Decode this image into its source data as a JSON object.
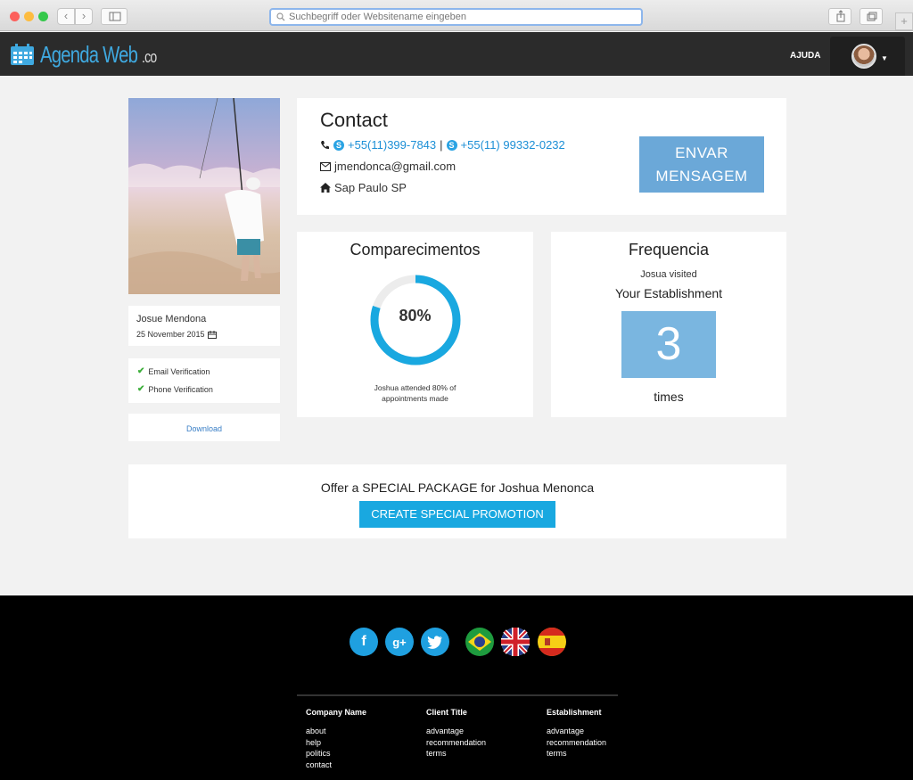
{
  "browser": {
    "url_placeholder": "Suchbegriff oder Websitename eingeben",
    "new_tab_label": "+"
  },
  "header": {
    "logo_main": "Agenda Web",
    "logo_sub": ".co",
    "help_label": "AJUDA"
  },
  "profile": {
    "name": "Josue Mendona",
    "date": "25 November 2015",
    "verifications": [
      "Email Verification",
      "Phone Verification"
    ],
    "download_label": "Download"
  },
  "contact": {
    "title": "Contact",
    "phone1": "+55(11)399-7843",
    "separator": "|",
    "phone2": "+55(11) 99332-0232",
    "email": "jmendonca@gmail.com",
    "address": "Sap Paulo SP",
    "send_label_1": "ENVAR",
    "send_label_2": "MENSAGEM"
  },
  "attendance": {
    "title": "Comparecimentos",
    "percent": 80,
    "percent_label": "80%",
    "caption_1": "Joshua attended 80% of",
    "caption_2": "appointments made"
  },
  "frequency": {
    "title": "Frequencia",
    "line1": "Josua visited",
    "line2": "Your Establishment",
    "count": "3",
    "unit": "times"
  },
  "promo": {
    "headline": "Offer a SPECIAL PACKAGE for Joshua Menonca",
    "button_label": "CREATE SPECIAL PROMOTION"
  },
  "footer": {
    "columns": [
      {
        "heading": "Company Name",
        "items": [
          "about",
          "help",
          "politics",
          "contact"
        ]
      },
      {
        "heading": "Client Title",
        "items": [
          "advantage",
          "recommendation",
          "terms"
        ]
      },
      {
        "heading": "Establishment",
        "items": [
          "advantage",
          "recommendation",
          "terms"
        ]
      }
    ]
  },
  "colors": {
    "accent": "#19a8e0",
    "nav_bg": "#2b2b2b",
    "send_button": "#6ba8d8",
    "count_box": "#7ab6e0"
  }
}
